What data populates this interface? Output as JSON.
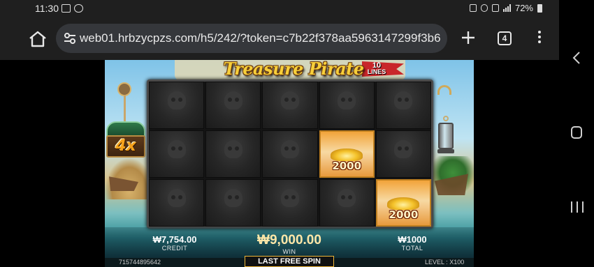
{
  "status_bar": {
    "time": "11:30",
    "battery": "72%"
  },
  "browser": {
    "url": "web01.hrbzycpzs.com/h5/242/?token=c7b22f378aa5963147299f3b6",
    "tab_count": "4"
  },
  "game": {
    "title": "Treasure Pirate",
    "lines_number": "10",
    "lines_label": "LINES",
    "multiplier": "4x",
    "reels": [
      [
        "skull",
        "skull",
        "skull",
        "skull",
        "skull"
      ],
      [
        "skull",
        "skull",
        "skull",
        "gold",
        "skull"
      ],
      [
        "skull",
        "skull",
        "skull",
        "skull",
        "gold"
      ]
    ],
    "gold_values": {
      "r1c3": "2000",
      "r2c4": "2000"
    },
    "credit_value": "₩7,754.00",
    "credit_label": "CREDIT",
    "win_value": "₩9,000.00",
    "win_label": "WIN",
    "total_value": "₩1000",
    "total_label": "TOTAL",
    "session_id": "715744895642",
    "last_free_spin": "LAST FREE SPIN",
    "level_label": "LEVEL :",
    "level_value": "X100"
  },
  "colors": {
    "accent_gold": "#f7cf3a",
    "frame_border": "#f0b73a"
  }
}
